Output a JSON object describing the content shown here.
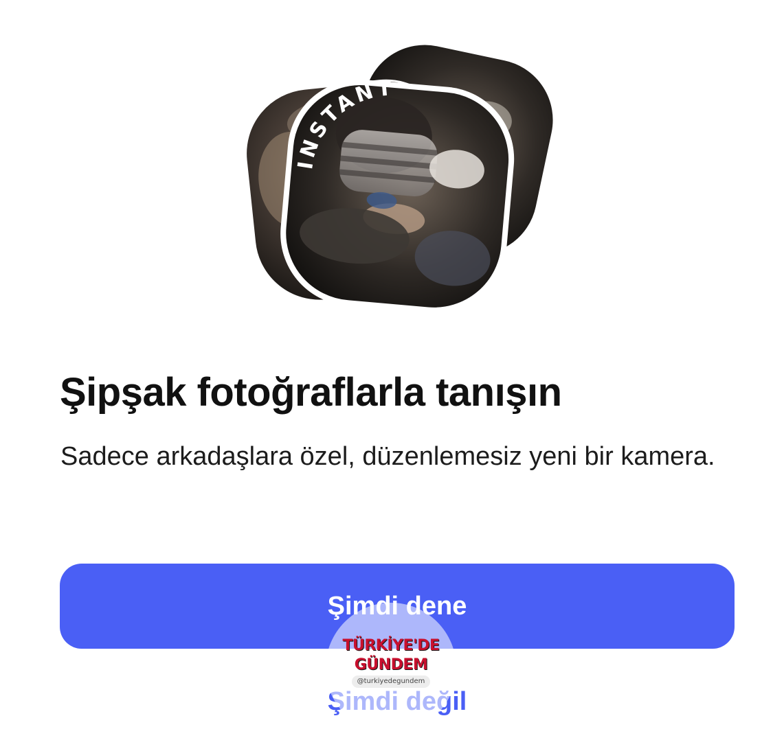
{
  "hero": {
    "badge_text": "INSTANTS",
    "icon": "instants-photo-stack"
  },
  "title": "Şipşak fotoğraflarla tanışın",
  "subtitle": "Sadece arkadaşlara özel, düzenlemesiz yeni bir kamera.",
  "primary_button": {
    "label": "Şimdi dene",
    "color": "#4a5ff5"
  },
  "secondary_button": {
    "label": "Şimdi değil",
    "color": "#4a5ff5"
  },
  "watermark": {
    "line1": "TÜRKİYE'DE",
    "line2": "GÜNDEM",
    "handle": "@turkiyedegundem"
  }
}
